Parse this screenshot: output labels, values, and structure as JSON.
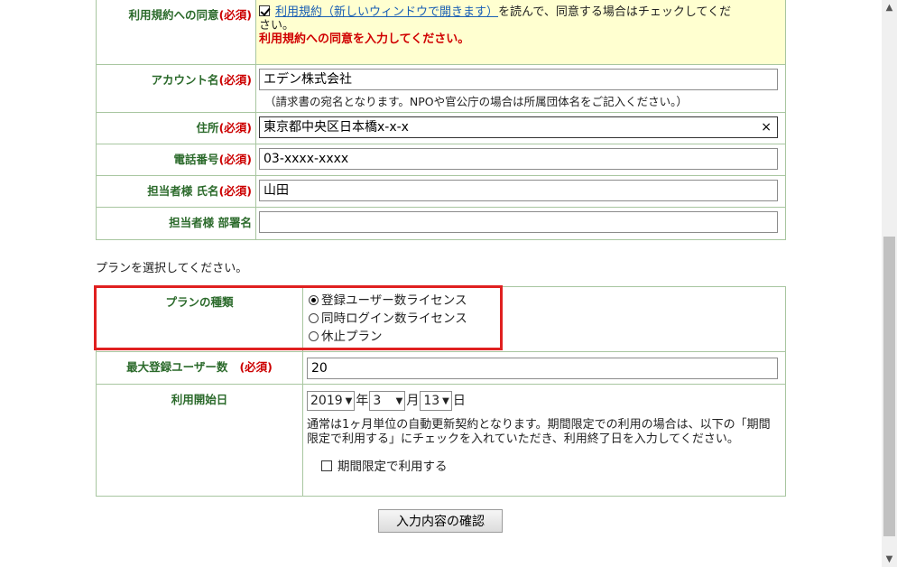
{
  "form": {
    "terms": {
      "label": "利用規約への同意",
      "required": "(必須)",
      "link_text": "利用規約（新しいウィンドウで開きます）",
      "text_after": "を読んで、同意する場合はチェックしてくだ",
      "text_wrap": "さい。",
      "error": "利用規約への同意を入力してください。",
      "checked": true
    },
    "account": {
      "label": "アカウント名",
      "required": "(必須)",
      "value": "エデン株式会社",
      "note": "（請求書の宛名となります。NPOや官公庁の場合は所属団体名をご記入ください。）"
    },
    "address": {
      "label": "住所",
      "required": "(必須)",
      "value": "東京都中央区日本橋x-x-x",
      "clear_icon": "×"
    },
    "phone": {
      "label": "電話番号",
      "required": "(必須)",
      "value": "03-xxxx-xxxx"
    },
    "contact_name": {
      "label": "担当者様 氏名",
      "required": "(必須)",
      "value": "山田"
    },
    "department": {
      "label": "担当者様 部署名",
      "value": ""
    }
  },
  "plan_prompt": "プランを選択してください。",
  "plan": {
    "label": "プランの種類",
    "options": [
      {
        "label": "登録ユーザー数ライセンス",
        "selected": true
      },
      {
        "label": "同時ログイン数ライセンス",
        "selected": false
      },
      {
        "label": "休止プラン",
        "selected": false
      }
    ]
  },
  "max_users": {
    "label": "最大登録ユーザー数",
    "required": "(必須)",
    "value": "20"
  },
  "start_date": {
    "label": "利用開始日",
    "year": "2019",
    "year_unit": "年",
    "month": "3",
    "month_unit": "月",
    "day": "13",
    "day_unit": "日",
    "description": "通常は1ヶ月単位の自動更新契約となります。期間限定での利用の場合は、以下の「期間限定で利用する」にチェックを入れていただき、利用終了日を入力してください。",
    "period_checkbox_label": "期間限定で利用する",
    "period_checked": false
  },
  "submit_label": "入力内容の確認",
  "colors": {
    "label_green": "#2b6a2b",
    "required_red": "#cc0000",
    "highlight": "#e02020",
    "terms_bg": "#ffffd0"
  }
}
